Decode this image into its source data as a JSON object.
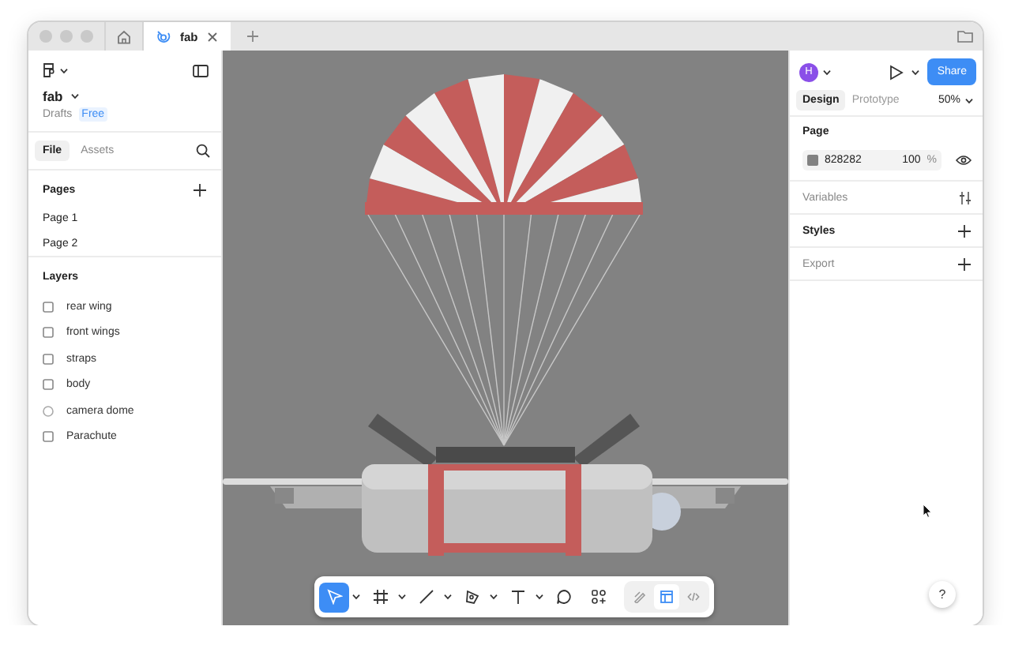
{
  "browser_tabs": [
    {
      "label": "fab",
      "selected": true
    }
  ],
  "file": {
    "name": "fab",
    "location": "Drafts",
    "plan": "Free"
  },
  "panel_tabs": [
    {
      "label": "File",
      "selected": true
    },
    {
      "label": "Assets",
      "selected": false
    }
  ],
  "pages": {
    "title": "Pages",
    "items": [
      {
        "label": "Page 1",
        "selected": false
      },
      {
        "label": "Page 2",
        "selected": false
      }
    ]
  },
  "layers": {
    "title": "Layers",
    "items": [
      {
        "label": "rear wing",
        "kind": "frame"
      },
      {
        "label": "front wings",
        "kind": "frame"
      },
      {
        "label": "straps",
        "kind": "frame"
      },
      {
        "label": "body",
        "kind": "frame"
      },
      {
        "label": "camera dome",
        "kind": "ellipse"
      },
      {
        "label": "Parachute",
        "kind": "frame"
      }
    ]
  },
  "toolbar": {
    "tools": [
      {
        "kind": "move",
        "selected": true,
        "menu": true
      },
      {
        "kind": "frame",
        "selected": false,
        "menu": true
      },
      {
        "kind": "line",
        "selected": false,
        "menu": true
      },
      {
        "kind": "pen",
        "selected": false,
        "menu": true
      },
      {
        "kind": "text",
        "selected": false,
        "menu": true
      },
      {
        "kind": "comment",
        "selected": false,
        "menu": false
      },
      {
        "kind": "actions",
        "selected": false,
        "menu": false
      }
    ],
    "modes": [
      {
        "kind": "draw",
        "selected": false
      },
      {
        "kind": "design",
        "selected": true
      },
      {
        "kind": "dev",
        "selected": false
      }
    ]
  },
  "right": {
    "avatar": "H",
    "share": "Share",
    "tabs": [
      {
        "label": "Design",
        "selected": true
      },
      {
        "label": "Prototype",
        "selected": false
      }
    ],
    "zoom": "50%",
    "page": {
      "title": "Page",
      "color": "828282",
      "opacity": "100",
      "unit": "%"
    },
    "sections": [
      {
        "title": "Variables",
        "kind": "variables",
        "disabled": true
      },
      {
        "title": "Styles",
        "kind": "styles",
        "disabled": false
      },
      {
        "title": "Export",
        "kind": "export",
        "disabled": true
      }
    ]
  },
  "help": "?"
}
